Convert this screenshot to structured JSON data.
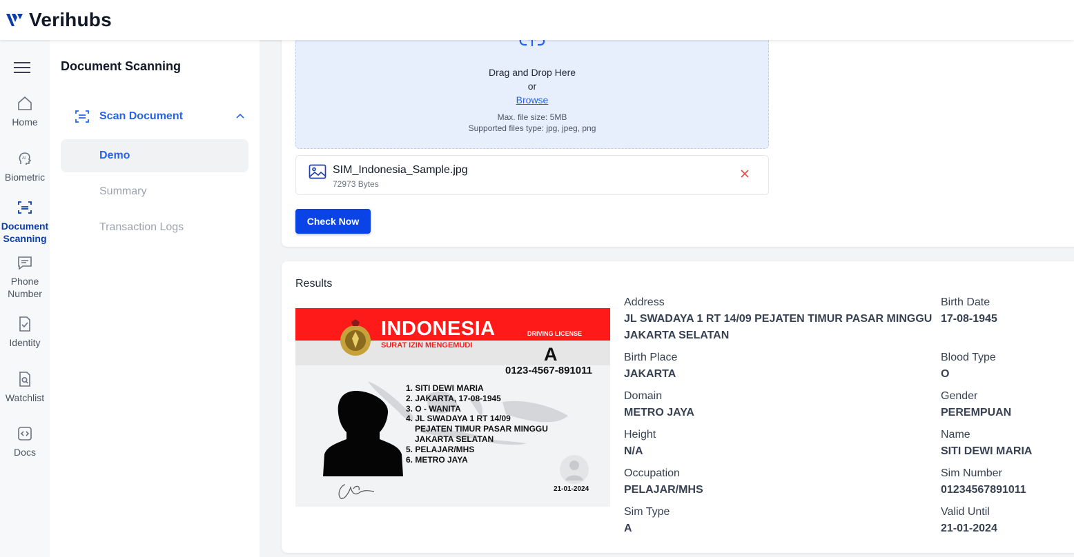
{
  "app": {
    "brand": "Verihubs"
  },
  "rail": [
    {
      "label": "Home",
      "icon": "home-icon"
    },
    {
      "label": "Biometric",
      "icon": "ai-head-icon"
    },
    {
      "label": "Document Scanning",
      "icon": "scan-document-icon",
      "active": true
    },
    {
      "label": "Phone Number",
      "icon": "chat-icon"
    },
    {
      "label": "Identity",
      "icon": "check-document-icon"
    },
    {
      "label": "Watchlist",
      "icon": "search-document-icon"
    },
    {
      "label": "Docs",
      "icon": "code-icon"
    }
  ],
  "subnav": {
    "title": "Document Scanning",
    "group": "Scan Document",
    "items": [
      {
        "label": "Demo",
        "active": true
      },
      {
        "label": "Summary"
      },
      {
        "label": "Transaction Logs"
      }
    ]
  },
  "upload": {
    "drag_text": "Drag and Drop Here",
    "or_text": "or",
    "browse_text": "Browse",
    "max_size": "Max. file size: 5MB",
    "supported": "Supported files type: jpg, jpeg, png",
    "file_name": "SIM_Indonesia_Sample.jpg",
    "file_size": "72973 Bytes",
    "check_button": "Check Now"
  },
  "results": {
    "title": "Results",
    "license_image": {
      "country": "INDONESIA",
      "doc_label": "DRIVING LICENSE",
      "local_label": "SURAT IZIN MENGEMUDI",
      "type": "A",
      "number": "0123-4567-891011",
      "lines": [
        "1. SITI DEWI MARIA",
        "2. JAKARTA, 17-08-1945",
        "3. O - WANITA",
        "4. JL SWADAYA 1 RT 14/09",
        "PEJATEN TIMUR PASAR MINGGU",
        "JAKARTA SELATAN",
        "5. PELAJAR/MHS",
        "6. METRO JAYA"
      ],
      "expiry": "21-01-2024"
    },
    "fields_left": [
      {
        "label": "Address",
        "value": "JL SWADAYA 1 RT 14/09 PEJATEN TIMUR PASAR MINGGU",
        "value2": "JAKARTA SELATAN"
      },
      {
        "label": "Birth Place",
        "value": "JAKARTA"
      },
      {
        "label": "Domain",
        "value": "METRO JAYA"
      },
      {
        "label": "Height",
        "value": "N/A"
      },
      {
        "label": "Occupation",
        "value": "PELAJAR/MHS"
      },
      {
        "label": "Sim Type",
        "value": "A"
      }
    ],
    "fields_right": [
      {
        "label": "Birth Date",
        "value": "17-08-1945"
      },
      {
        "label": "Blood Type",
        "value": "O"
      },
      {
        "label": "Gender",
        "value": "PEREMPUAN"
      },
      {
        "label": "Name",
        "value": "SITI DEWI MARIA"
      },
      {
        "label": "Sim Number",
        "value": "01234567891011"
      },
      {
        "label": "Valid Until",
        "value": "21-01-2024"
      }
    ]
  },
  "colors": {
    "accent": "#2563eb",
    "button": "#0a44e6",
    "dropzone": "#e7effd",
    "remove": "#ef4444"
  }
}
